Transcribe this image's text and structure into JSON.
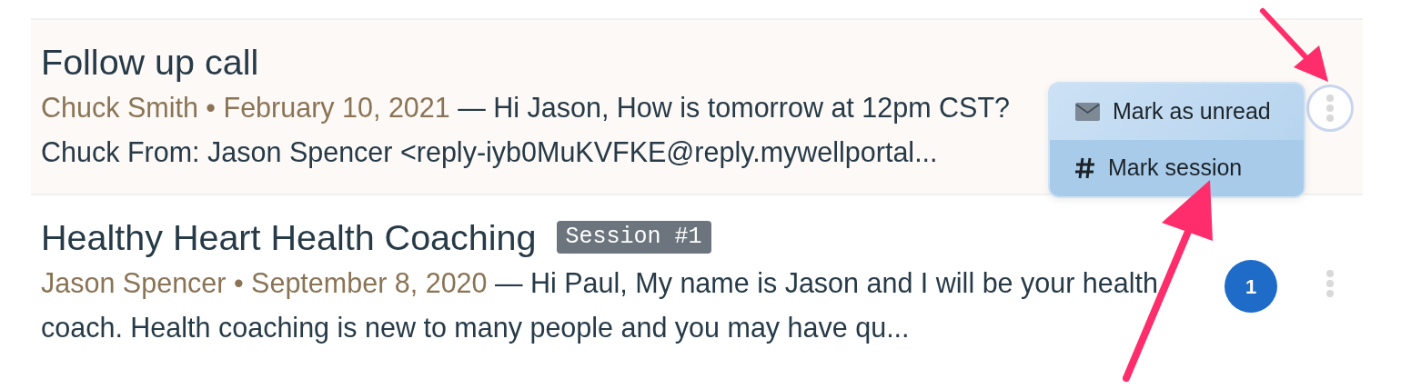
{
  "messages": [
    {
      "title": "Follow up call",
      "highlighted": true,
      "meta": "Chuck Smith • February 10, 2021",
      "preview": "— Hi Jason,  How is tomorrow at 12pm CST?\nChuck From: Jason Spencer <reply-iyb0MuKVFKE@reply.mywellportal...",
      "menu_open": true
    },
    {
      "title": "Healthy Heart Health Coaching",
      "tag": "Session #1",
      "highlighted": false,
      "meta": "Jason Spencer • September 8, 2020",
      "preview": "— Hi Paul, My name is Jason and I will be your health\ncoach. Health coaching is new to many people and you may have qu...",
      "badge": "1",
      "menu_open": false
    }
  ],
  "menu": {
    "items": [
      {
        "kind": "envelope",
        "label": "Mark as unread",
        "highlighted": false
      },
      {
        "kind": "hash",
        "label": "Mark session",
        "highlighted": true
      }
    ]
  },
  "annotations": [
    {
      "kind": "arrow"
    },
    {
      "kind": "arrow"
    }
  ]
}
